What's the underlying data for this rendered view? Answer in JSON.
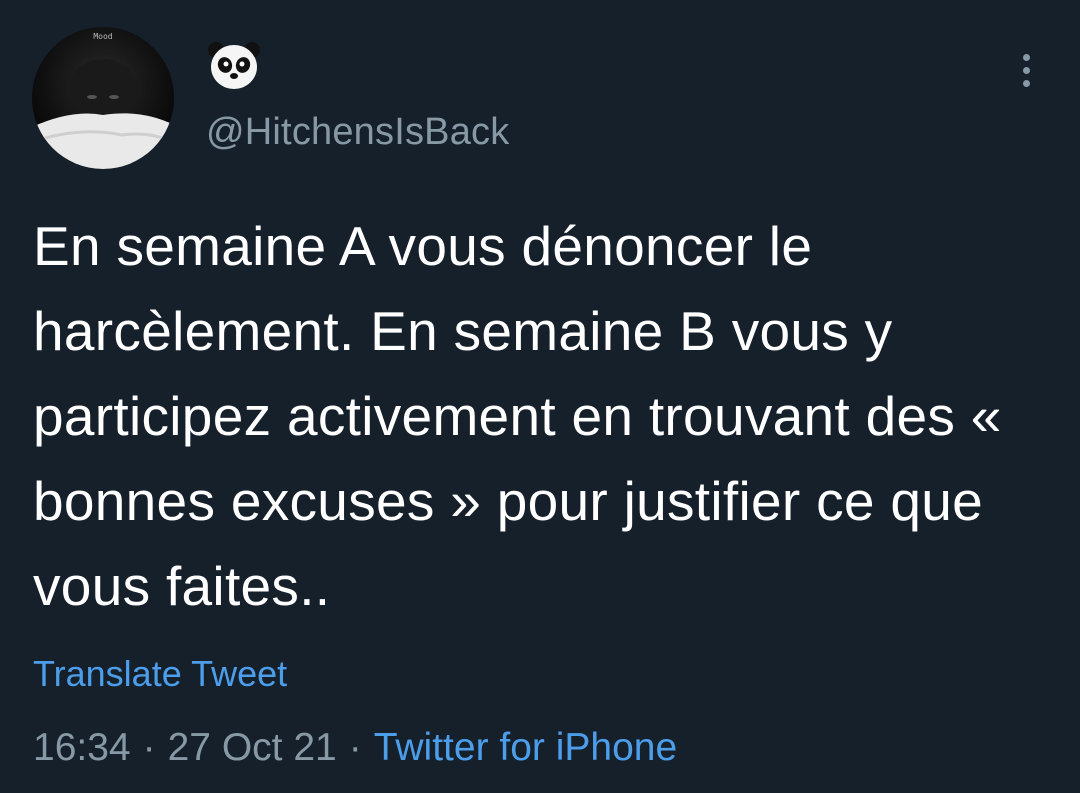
{
  "author": {
    "avatar_text": "Mood",
    "display_name_icon": "panda-emoji-icon",
    "handle": "@HitchensIsBack"
  },
  "tweet": {
    "text": "En semaine A vous dénoncer le harcèlement. En semaine B vous y participez activement en trouvant des « bonnes excuses » pour justifier ce que vous faites..",
    "translate_label": "Translate Tweet",
    "time": "16:34",
    "date": "27 Oct 21",
    "separator": "·",
    "source": "Twitter for iPhone"
  },
  "actions": {
    "more_icon": "more-vertical-icon"
  },
  "colors": {
    "background": "#15202b",
    "text": "#ffffff",
    "secondary": "#8899a6",
    "link": "#4c9eeb"
  }
}
